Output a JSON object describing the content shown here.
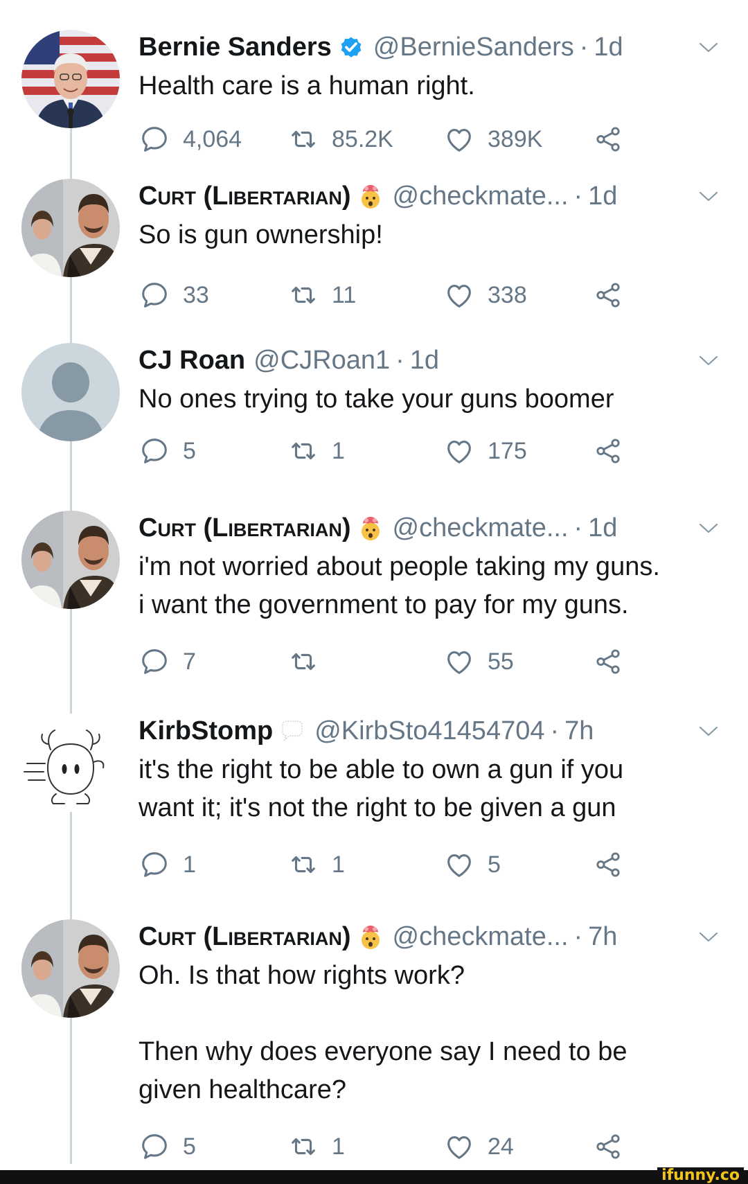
{
  "colors": {
    "text": "#14171a",
    "muted": "#657786",
    "thread_line": "#ccd6dd",
    "verified": "#1da1f2",
    "watermark": "#f3c41b"
  },
  "tweets": [
    {
      "name": "Bernie Sanders",
      "name_style": "normal",
      "verified": true,
      "emoji_badge": "",
      "handle": "@BernieSanders",
      "time": "1d",
      "body": [
        "Health care is a human right."
      ],
      "replies": "4,064",
      "retweets": "85.2K",
      "likes": "389K",
      "avatar": "bernie-sanders-photo"
    },
    {
      "name": "Curt (Libertarian)",
      "name_style": "small-caps",
      "verified": false,
      "emoji_badge": "exploding-head-emoji",
      "handle": "@checkmate...",
      "time": "1d",
      "body": [
        "So is gun ownership!"
      ],
      "replies": "33",
      "retweets": "11",
      "likes": "338",
      "avatar": "curt-avatar-photo"
    },
    {
      "name": "CJ Roan",
      "name_style": "normal",
      "verified": false,
      "emoji_badge": "",
      "handle": "@CJRoan1",
      "time": "1d",
      "body": [
        "No ones trying to take your guns boomer"
      ],
      "replies": "5",
      "retweets": "1",
      "likes": "175",
      "avatar": "default-profile-avatar"
    },
    {
      "name": "Curt (Libertarian)",
      "name_style": "small-caps",
      "verified": false,
      "emoji_badge": "exploding-head-emoji",
      "handle": "@checkmate...",
      "time": "1d",
      "body": [
        "i'm not worried about people taking my guns.",
        "i want the government to pay for my guns."
      ],
      "replies": "7",
      "retweets": "",
      "likes": "55",
      "avatar": "curt-avatar-photo"
    },
    {
      "name": "KirbStomp",
      "name_style": "normal",
      "verified": false,
      "emoji_badge": "speech-bubble-emoji",
      "handle": "@KirbSto41454704",
      "time": "7h",
      "body": [
        "it's the right to be able to own a gun if you",
        "want it; it's not the right to be given a gun"
      ],
      "replies": "1",
      "retweets": "1",
      "likes": "5",
      "avatar": "drawn-character-avatar"
    },
    {
      "name": "Curt (Libertarian)",
      "name_style": "small-caps",
      "verified": false,
      "emoji_badge": "exploding-head-emoji",
      "handle": "@checkmate...",
      "time": "7h",
      "body": [
        "Oh. Is that how rights work?",
        "",
        "Then why does everyone say I need to be",
        "given healthcare?"
      ],
      "replies": "5",
      "retweets": "1",
      "likes": "24",
      "avatar": "curt-avatar-photo"
    }
  ],
  "watermark": "ifunny.co"
}
